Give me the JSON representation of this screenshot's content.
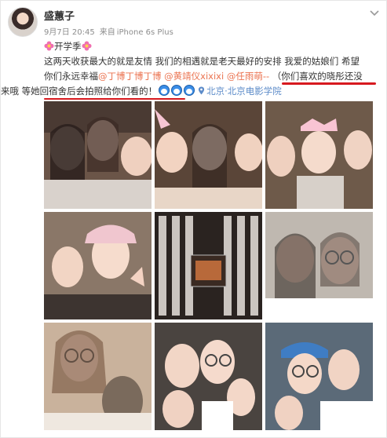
{
  "user": {
    "name": "盛蕙子"
  },
  "post": {
    "date": "9月7日 20:45",
    "source_prefix": "来自",
    "source": "iPhone 6s Plus",
    "topic": "开学季",
    "line1": "这两天收获最大的就是友情 我们的相遇就是老天最好的安排 我爱的姑娘们 希望",
    "line2_pre": "你们永远幸福",
    "mentions": [
      "@丁博丁博丁博",
      "@黄靖仪xixixi",
      "@任雨萌--"
    ],
    "paren_open": "（",
    "quote_red_1": "你们喜欢的晓彤还没",
    "quote_red_2": "来哦 等她回宿舍后会拍照给你们看的！",
    "location": "北京·北京电影学院"
  },
  "icons": {
    "more": "chevron-down-icon",
    "topic": "flower-icon",
    "location": "location-pin-icon",
    "emoji": "doraemon-emoji-icon"
  },
  "colors": {
    "mention": "#eb7350",
    "link": "#5d8cc9",
    "underline": "#d7191f"
  }
}
